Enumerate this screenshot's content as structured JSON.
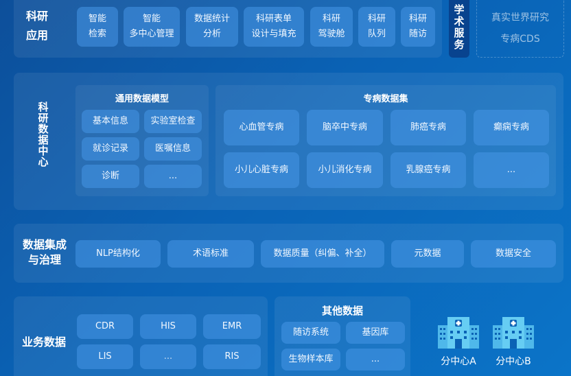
{
  "research_apps": {
    "label": "科研\n应用",
    "items": [
      "智能\n检索",
      "智能\n多中心管理",
      "数据统计\n分析",
      "科研表单\n设计与填充",
      "科研\n驾驶舱",
      "科研\n队列",
      "科研\n随访"
    ],
    "academic": "学\n术\n服\n务",
    "rwe_title": "真实世界研究",
    "rwe_sub": "专病CDS"
  },
  "data_center": {
    "label": "科\n研\n数\n据\n中\n心",
    "general_model": {
      "title": "通用数据模型",
      "items": [
        "基本信息",
        "实验室检查",
        "就诊记录",
        "医嘱信息",
        "诊断",
        "..."
      ]
    },
    "disease_sets": {
      "title": "专病数据集",
      "items": [
        "心血管专病",
        "脑卒中专病",
        "肺癌专病",
        "癫痫专病",
        "小儿心脏专病",
        "小儿消化专病",
        "乳腺癌专病",
        "..."
      ]
    }
  },
  "integration": {
    "label": "数据集成\n与治理",
    "items": [
      "NLP结构化",
      "术语标准",
      "数据质量（纠偏、补全）",
      "元数据",
      "数据安全"
    ]
  },
  "business": {
    "label": "业务数据",
    "items": [
      "CDR",
      "HIS",
      "EMR",
      "LIS",
      "...",
      "RIS"
    ]
  },
  "other": {
    "title": "其他数据",
    "items": [
      "随访系统",
      "基因库",
      "生物样本库",
      "..."
    ]
  },
  "branches": [
    "分中心A",
    "分中心B"
  ],
  "colors": {
    "background": "#0a62b5",
    "tile": "#4696e6",
    "building": "#5cc8f0"
  }
}
